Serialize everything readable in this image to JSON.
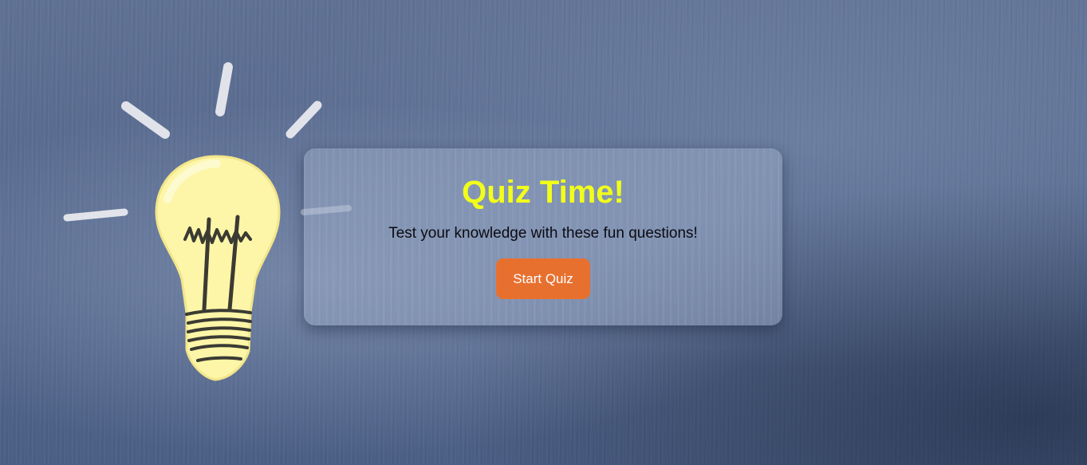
{
  "quiz_card": {
    "title": "Quiz Time!",
    "subtitle": "Test your knowledge with these fun questions!",
    "start_button_label": "Start Quiz"
  },
  "colors": {
    "title": "#f2ff1a",
    "button": "#e8702f",
    "button_text": "#ffffff",
    "background": "#56698e"
  },
  "icons": [
    "lightbulb-icon"
  ]
}
